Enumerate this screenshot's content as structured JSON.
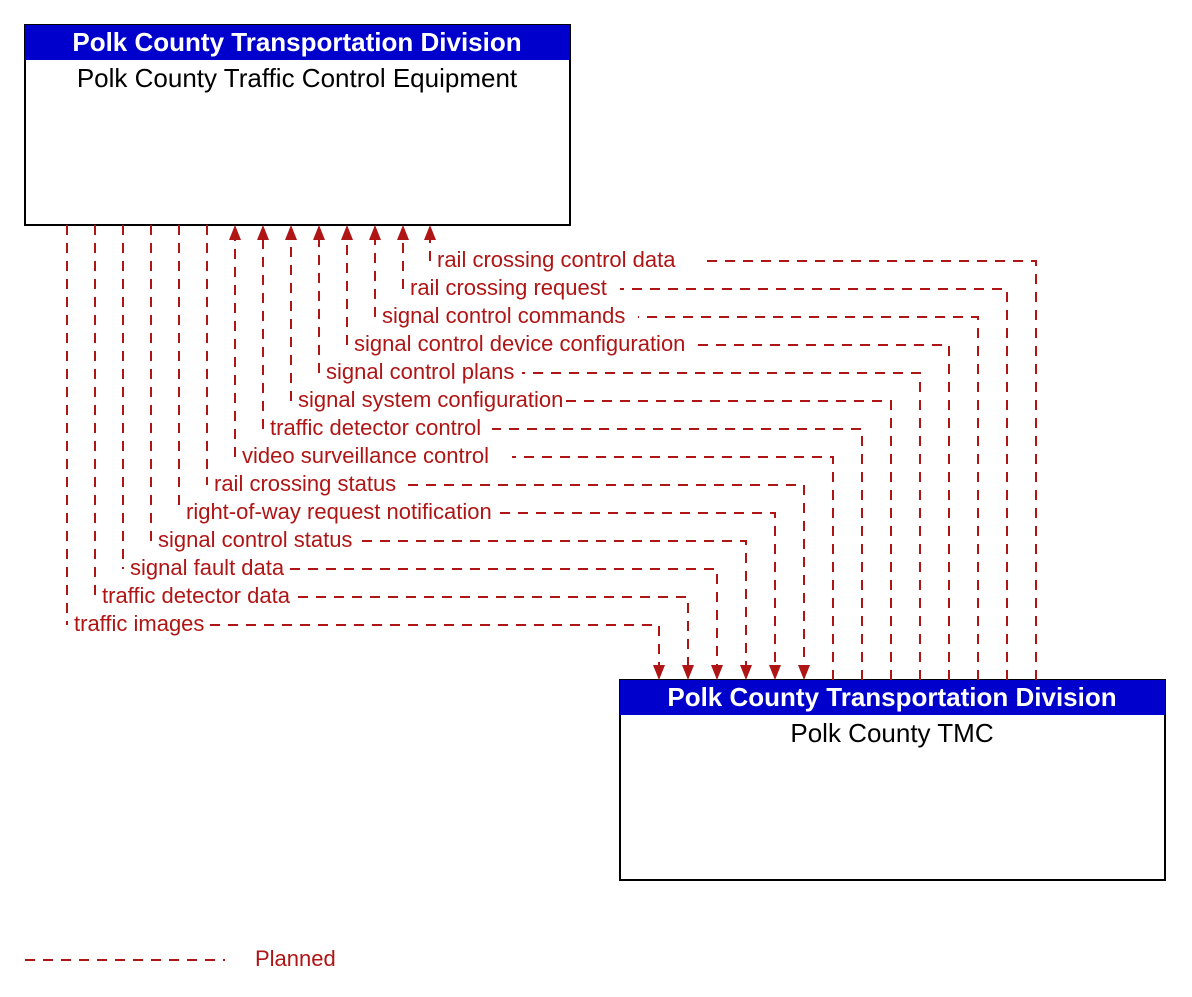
{
  "topBox": {
    "header": "Polk County Transportation Division",
    "title": "Polk County Traffic Control Equipment"
  },
  "bottomBox": {
    "header": "Polk County Transportation Division",
    "title": "Polk County TMC"
  },
  "legend": {
    "label": "Planned"
  },
  "flows": {
    "toTop": [
      "rail crossing control data",
      "rail crossing request",
      "signal control commands",
      "signal control device configuration",
      "signal control plans",
      "signal system configuration",
      "traffic detector control",
      "video surveillance control"
    ],
    "toBottom": [
      "rail crossing status",
      "right-of-way request notification",
      "signal control status",
      "signal fault data",
      "traffic detector data",
      "traffic images"
    ]
  },
  "colors": {
    "header": "#0000cc",
    "flow": "#b01515"
  }
}
